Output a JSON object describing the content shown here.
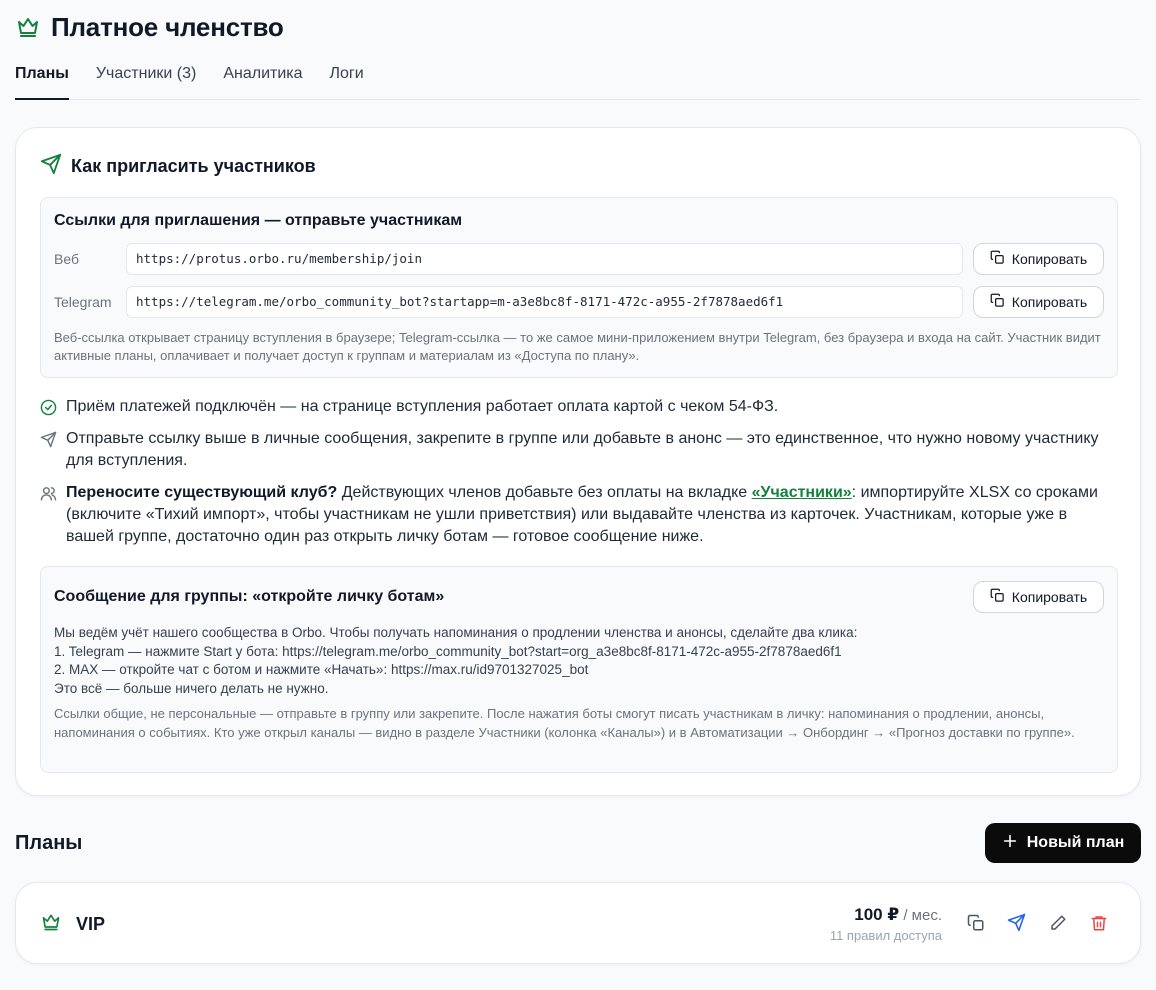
{
  "header": {
    "title": "Платное членство",
    "icon": "crown-icon"
  },
  "tabs": [
    {
      "label": "Планы",
      "active": true
    },
    {
      "label": "Участники (3)",
      "active": false
    },
    {
      "label": "Аналитика",
      "active": false
    },
    {
      "label": "Логи",
      "active": false
    }
  ],
  "invite": {
    "title": "Как пригласить участников",
    "links_box": {
      "title": "Ссылки для приглашения — отправьте участникам",
      "rows": [
        {
          "label": "Веб",
          "url": "https://protus.orbo.ru/membership/join",
          "copy_label": "Копировать"
        },
        {
          "label": "Telegram",
          "url": "https://telegram.me/orbo_community_bot?startapp=m-a3e8bc8f-8171-472c-a955-2f7878aed6f1",
          "copy_label": "Копировать"
        }
      ],
      "note": "Веб-ссылка открывает страницу вступления в браузере; Telegram-ссылка — то же самое мини-приложением внутри Telegram, без браузера и входа на сайт. Участник видит активные планы, оплачивает и получает доступ к группам и материалам из «Доступа по плану»."
    },
    "bullets": {
      "payments": "Приём платежей подключён — на странице вступления работает оплата картой с чеком 54-ФЗ.",
      "send": "Отправьте ссылку выше в личные сообщения, закрепите в группе или добавьте в анонс — это единственное, что нужно новому участнику для вступления.",
      "migrate_bold": "Переносите существующий клуб?",
      "migrate_pre": " Действующих членов добавьте без оплаты на вкладке ",
      "migrate_link": "«Участники»",
      "migrate_post": ": импортируйте XLSX со сроками (включите «Тихий импорт», чтобы участникам не ушли приветствия) или выдавайте членства из карточек. Участникам, которые уже в вашей группе, достаточно один раз открыть личку ботам — готовое сообщение ниже."
    },
    "message_box": {
      "title": "Сообщение для группы: «откройте личку ботам»",
      "copy_label": "Копировать",
      "lines": [
        "Мы ведём учёт нашего сообщества в Orbo. Чтобы получать напоминания о продлении членства и анонсы, сделайте два клика:",
        "1. Telegram — нажмите Start у бота: https://telegram.me/orbo_community_bot?start=org_a3e8bc8f-8171-472c-a955-2f7878aed6f1",
        "2. MAX — откройте чат с ботом и нажмите «Начать»: https://max.ru/id9701327025_bot",
        "Это всё — больше ничего делать не нужно."
      ],
      "note": "Ссылки общие, не персональные — отправьте в группу или закрепите. После нажатия боты смогут писать участникам в личку: напоминания о продлении, анонсы, напоминания о событиях. Кто уже открыл каналы — видно в разделе Участники (колонка «Каналы») и в Автоматизации → Онбординг → «Прогноз доставки по группе»."
    }
  },
  "plans": {
    "title": "Планы",
    "new_plan_label": "Новый план",
    "items": [
      {
        "name": "VIP",
        "price": "100 ₽",
        "period": " / мес.",
        "rules": "11 правил доступа"
      }
    ]
  },
  "colors": {
    "accent_green": "#15803d",
    "danger": "#ef4444",
    "send_blue": "#2563eb"
  }
}
